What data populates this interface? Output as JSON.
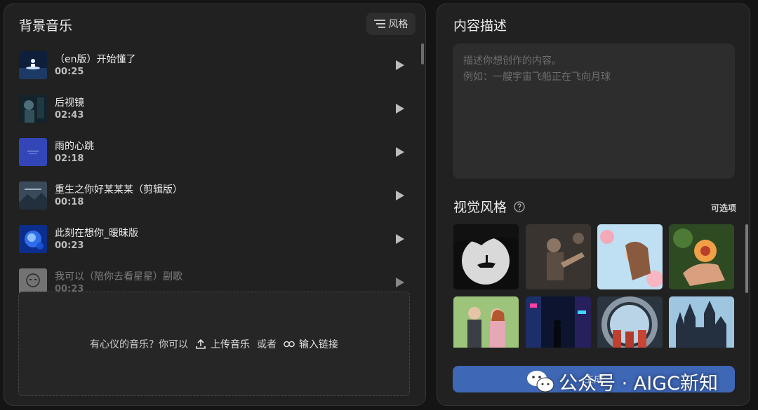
{
  "music_panel": {
    "title": "背景音乐",
    "style_button": "风格",
    "tracks": [
      {
        "name": "（en版）开始懂了",
        "duration": "00:25",
        "cover": "moon-boat-cover"
      },
      {
        "name": "后视镜",
        "duration": "02:43",
        "cover": "night-portrait-cover"
      },
      {
        "name": "雨的心跳",
        "duration": "02:18",
        "cover": "blue-text-cover"
      },
      {
        "name": "重生之你好某某某（剪辑版）",
        "duration": "00:18",
        "cover": "misty-mountain-cover"
      },
      {
        "name": "此刻在想你_暧昧版",
        "duration": "00:23",
        "cover": "blue-splash-cover"
      },
      {
        "name": "我可以（陪你去看星星）副歌",
        "duration": "00:23",
        "cover": "sketch-face-cover"
      }
    ],
    "upload": {
      "prompt": "有心仪的音乐？你可以",
      "upload_label": "上传音乐",
      "or_label": "或者",
      "link_label": "输入链接"
    }
  },
  "content_panel": {
    "title": "内容描述",
    "description_placeholder": "描述你想创作的内容。\n例如：一艘宇宙飞船正在飞向月球",
    "visual_style": {
      "title": "视觉风格",
      "optional_label": "可选项",
      "styles": [
        {
          "name": "silhouette-moon"
        },
        {
          "name": "rock-guitarist"
        },
        {
          "name": "dreamy-girl-flowers"
        },
        {
          "name": "peach-in-hand"
        },
        {
          "name": "couple-in-garden"
        },
        {
          "name": "cyberpunk-street"
        },
        {
          "name": "astronauts-portal"
        },
        {
          "name": "gothic-castle"
        }
      ]
    },
    "generate_button": "生成"
  },
  "watermark": {
    "text": "公众号 · AIGC新知"
  },
  "colors": {
    "accent": "#3e67b6",
    "panel_bg": "#212121",
    "page_bg": "#141414"
  }
}
